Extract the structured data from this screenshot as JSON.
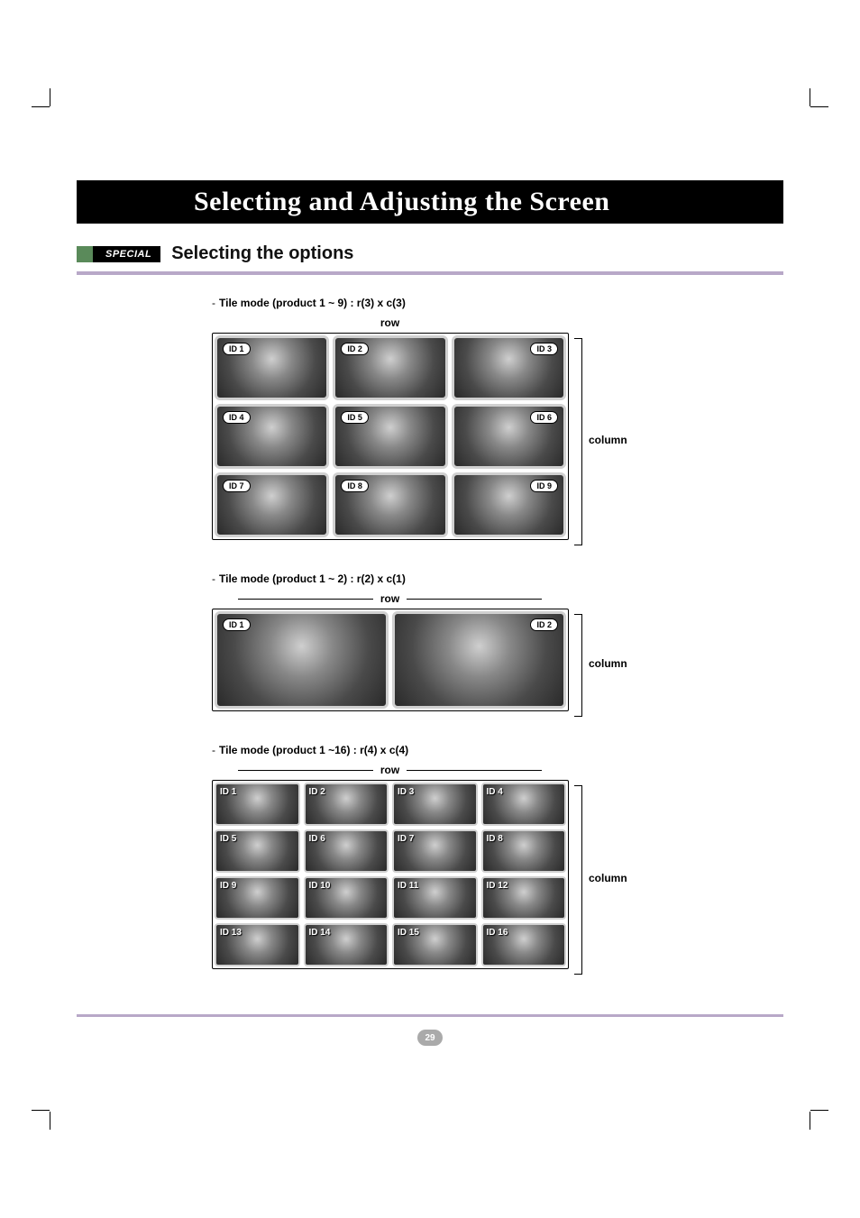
{
  "page": {
    "title": "Selecting and Adjusting the Screen",
    "special_badge": "SPECIAL",
    "subheading": "Selecting the options",
    "page_number": "29"
  },
  "sections": {
    "s1": {
      "caption": "Tile mode (product 1 ~ 9) : r(3) x c(3)",
      "row_label": "row",
      "col_label": "column",
      "ids": [
        "ID 1",
        "ID 2",
        "ID 3",
        "ID 4",
        "ID 5",
        "ID 6",
        "ID 7",
        "ID 8",
        "ID 9"
      ]
    },
    "s2": {
      "caption": "Tile mode (product 1 ~ 2) : r(2) x c(1)",
      "row_label": "row",
      "col_label": "column",
      "ids": [
        "ID 1",
        "ID 2"
      ]
    },
    "s3": {
      "caption": "Tile mode (product 1 ~16) : r(4) x c(4)",
      "row_label": "row",
      "col_label": "column",
      "ids": [
        "ID 1",
        "ID 2",
        "ID 3",
        "ID 4",
        "ID 5",
        "ID 6",
        "ID 7",
        "ID 8",
        "ID 9",
        "ID 10",
        "ID 11",
        "ID 12",
        "ID 13",
        "ID 14",
        "ID 15",
        "ID 16"
      ]
    }
  }
}
